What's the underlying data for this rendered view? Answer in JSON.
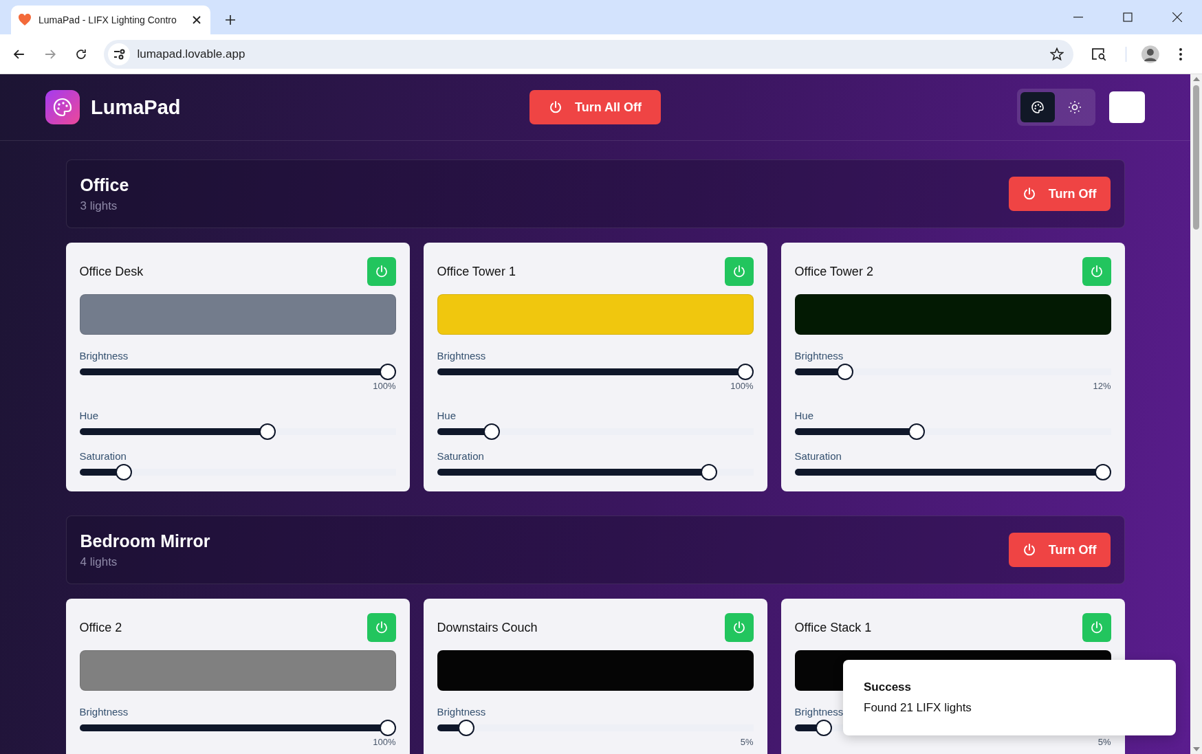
{
  "browser": {
    "tab_title": "LumaPad - LIFX Lighting Contro",
    "url": "lumapad.lovable.app"
  },
  "header": {
    "brand": "LumaPad",
    "turn_all_off": "Turn All Off",
    "modes": [
      {
        "kind": "palette",
        "selected": true
      },
      {
        "kind": "sun",
        "selected": false
      }
    ]
  },
  "groups": [
    {
      "name": "Office",
      "count": "3 lights",
      "button": "Turn Off",
      "lights": [
        {
          "name": "Office Desk",
          "on": true,
          "color": "#737c8c",
          "controls": [
            {
              "label": "Brightness",
              "level": 1.0,
              "reading": "100%"
            },
            {
              "label": "Hue",
              "level": 0.6
            },
            {
              "label": "Saturation",
              "level": 0.12
            }
          ]
        },
        {
          "name": "Office Tower 1",
          "on": true,
          "color": "#f0c70e",
          "controls": [
            {
              "label": "Brightness",
              "level": 1.0,
              "reading": "100%"
            },
            {
              "label": "Hue",
              "level": 0.155
            },
            {
              "label": "Saturation",
              "level": 0.88
            }
          ]
        },
        {
          "name": "Office Tower 2",
          "on": true,
          "color": "#031a03",
          "controls": [
            {
              "label": "Brightness",
              "level": 0.14,
              "reading": "12%"
            },
            {
              "label": "Hue",
              "level": 0.38
            },
            {
              "label": "Saturation",
              "level": 1.0
            }
          ]
        }
      ]
    },
    {
      "name": "Bedroom Mirror",
      "count": "4 lights",
      "button": "Turn Off",
      "lights": [
        {
          "name": "Office 2",
          "on": true,
          "color": "#808080",
          "controls": [
            {
              "label": "Brightness",
              "level": 1.0,
              "reading": "100%"
            }
          ]
        },
        {
          "name": "Downstairs Couch",
          "on": true,
          "color": "#050505",
          "controls": [
            {
              "label": "Brightness",
              "level": 0.07,
              "reading": "5%"
            }
          ]
        },
        {
          "name": "Office Stack 1",
          "on": true,
          "color": "#050505",
          "controls": [
            {
              "label": "Brightness",
              "level": 0.07,
              "reading": "5%"
            }
          ]
        }
      ]
    }
  ],
  "toast": {
    "title": "Success",
    "message": "Found 21 LIFX lights"
  }
}
